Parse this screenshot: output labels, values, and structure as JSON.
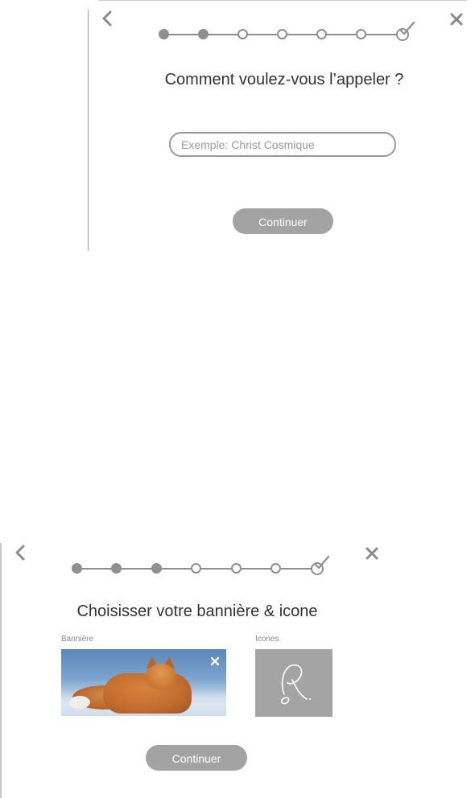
{
  "screen1": {
    "back_icon": "chevron-left-icon",
    "close_icon": "close-icon",
    "stepper": {
      "total_steps": 7,
      "completed_steps": 2,
      "final_icon": "check-circle-icon"
    },
    "title": "Comment voulez-vous l’appeler ?",
    "name_input": {
      "value": "",
      "placeholder": "Exemple: Christ Cosmique"
    },
    "continue_label": "Continuer"
  },
  "screen2": {
    "back_icon": "chevron-left-icon",
    "close_icon": "close-icon",
    "stepper": {
      "total_steps": 7,
      "completed_steps": 3,
      "final_icon": "check-circle-icon"
    },
    "title": "Choisisser votre bannière & icone",
    "banner_label": "Bannière",
    "banner_image": "fox-in-snow-photo",
    "banner_remove_icon": "close-icon",
    "icons_label": "Icones",
    "icon_image": "signature-logo",
    "continue_label": "Continuer"
  },
  "colors": {
    "accent_gray": "#8f8f8f",
    "button_gray": "#a3a3a3",
    "icon_box_gray": "#a4a4a4",
    "text": "#333333"
  }
}
